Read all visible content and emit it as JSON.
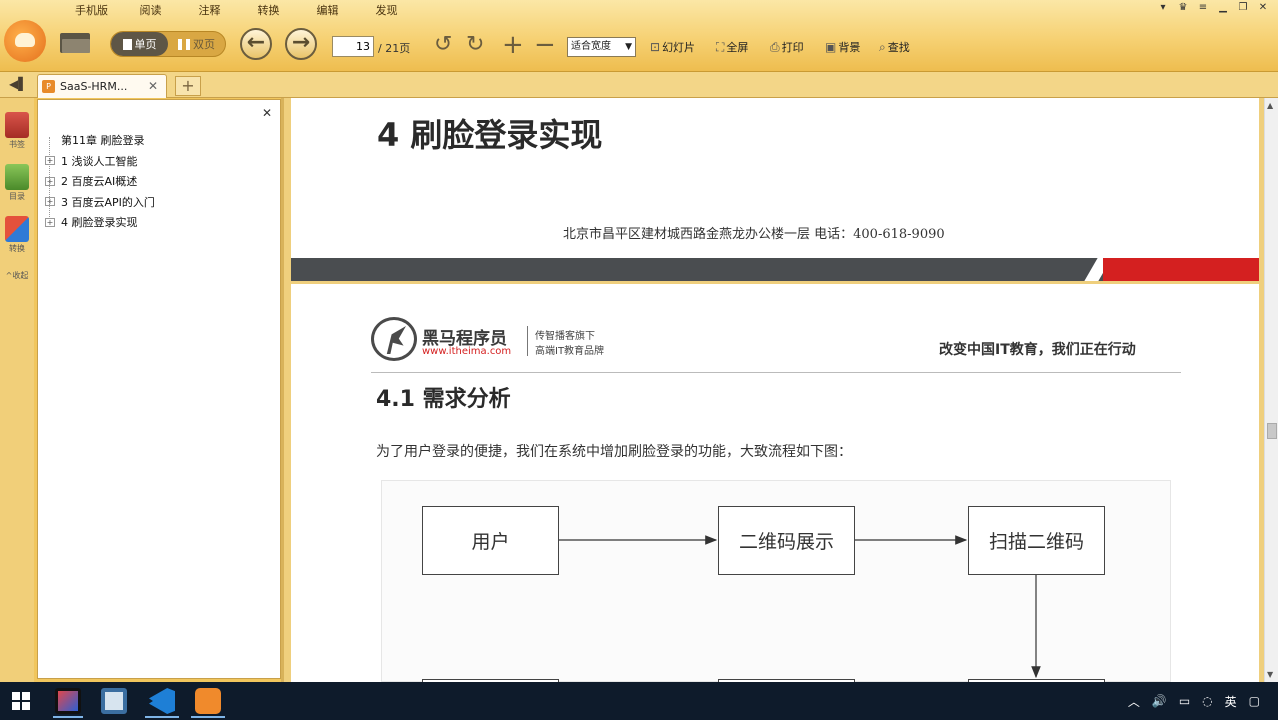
{
  "menu": [
    "手机版",
    "阅读",
    "注释",
    "转换",
    "编辑",
    "发现"
  ],
  "toolbar": {
    "single_page": "单页",
    "double_page": "双页",
    "current_page": "13",
    "total_pages": "/ 21页",
    "zoom_mode": "适合宽度",
    "slideshow": "幻灯片",
    "fullscreen": "全屏",
    "print": "打印",
    "background": "背景",
    "search": "查找"
  },
  "tab": {
    "title": "SaaS-HRM..."
  },
  "dock": {
    "bookmark": "书签",
    "toc": "目录",
    "convert": "转换",
    "collapse": "收起"
  },
  "outline": {
    "root": "第11章 刷脸登录",
    "items": [
      "1 浅谈人工智能",
      "2 百度云AI概述",
      "3 百度云API的入门",
      "4 刷脸登录实现"
    ]
  },
  "page_top": {
    "heading": "4 刷脸登录实现",
    "address": "北京市昌平区建材城西路金燕龙办公楼一层   电话：400-618-9090"
  },
  "page_main": {
    "brand_name": "黑马程序员",
    "brand_url": "www.itheima.com",
    "brand_tag1": "传智播客旗下",
    "brand_tag2": "高端IT教育品牌",
    "slogan": "改变中国IT教育，我们正在行动",
    "section_heading": "4.1 需求分析",
    "body": "为了用户登录的便捷，我们在系统中增加刷脸登录的功能，大致流程如下图："
  },
  "flow": {
    "user": "用户",
    "qr_display": "二维码展示",
    "scan_qr": "扫描二维码"
  },
  "tray": {
    "ime": "英"
  }
}
